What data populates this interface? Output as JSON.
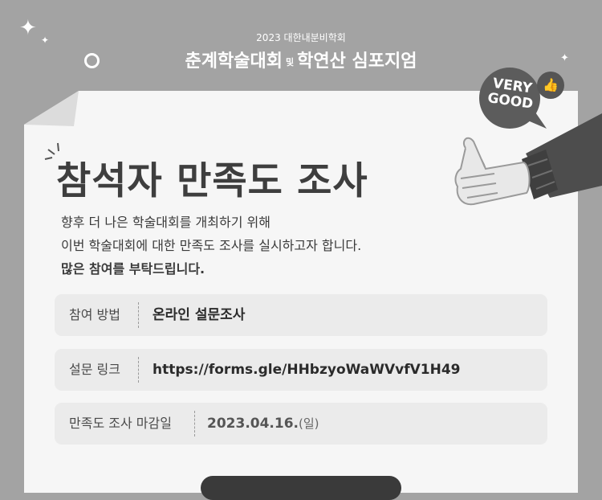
{
  "header": {
    "subtitle": "2023 대한내분비학회",
    "title_part1": "춘계학술대회",
    "title_joiner": "및",
    "title_part2": "학연산 심포지엄"
  },
  "badge": {
    "line1": "VERY",
    "line2": "GOOD",
    "icon": "thumbs-up-icon"
  },
  "survey": {
    "title": "참석자 만족도 조사",
    "intro": {
      "line1": "향후 더 나은 학술대회를 개최하기 위해",
      "line2": "이번 학술대회에 대한 만족도 조사를 실시하고자 합니다.",
      "line3": "많은 참여를 부탁드립니다."
    },
    "rows": [
      {
        "label": "참여 방법",
        "value": "온라인 설문조사"
      },
      {
        "label": "설문 링크",
        "value": "https://forms.gle/HHbzyoWaWVvfV1H49"
      },
      {
        "label": "만족도 조사 마감일",
        "value": "2023.04.16.",
        "suffix": "(일)"
      }
    ]
  },
  "colors": {
    "background": "#a3a3a3",
    "paper": "#f6f6f6",
    "row": "#ebebeb",
    "title": "#3e3e3e"
  }
}
